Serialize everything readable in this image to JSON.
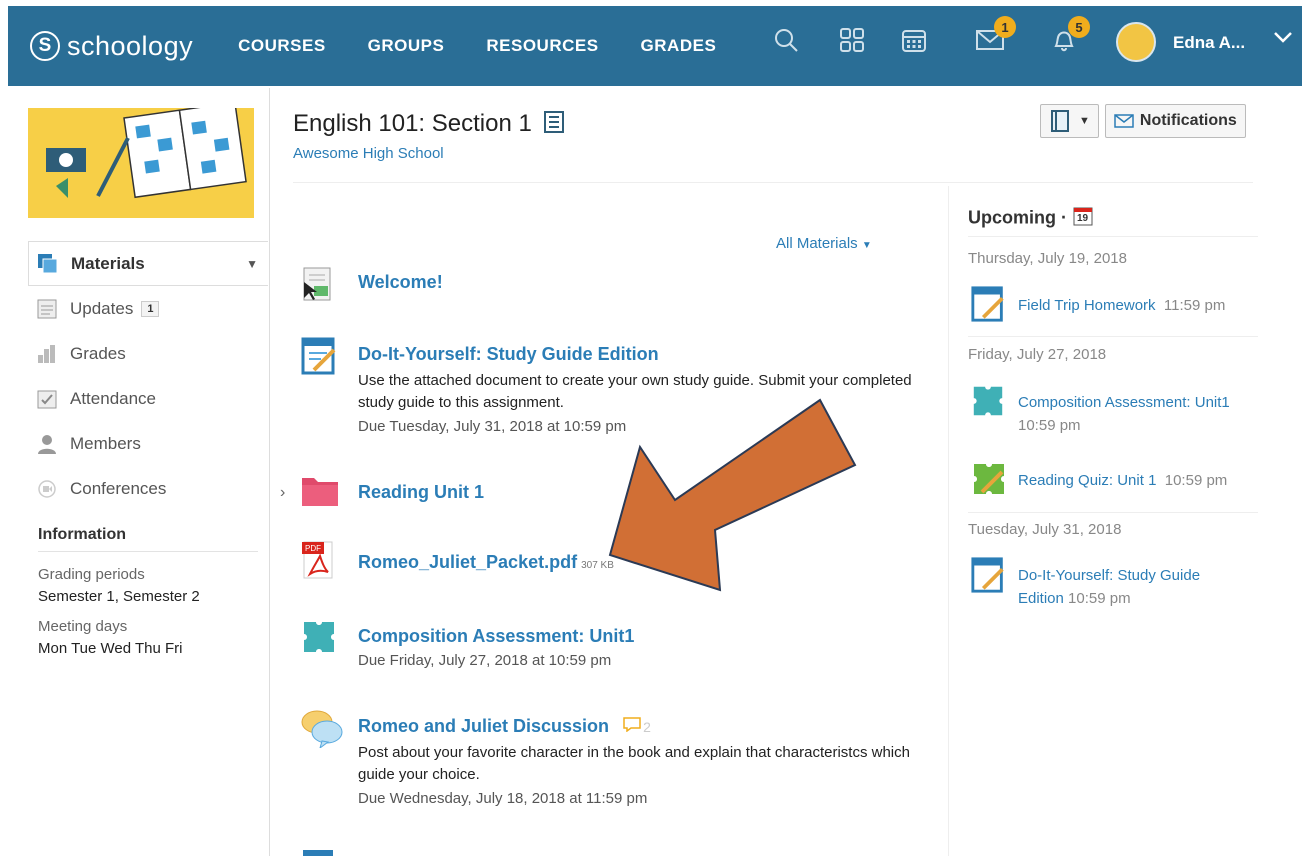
{
  "nav": {
    "logo_text": "schoology",
    "logo_letter": "S",
    "links": [
      "COURSES",
      "GROUPS",
      "RESOURCES",
      "GRADES"
    ],
    "messages_count": "1",
    "notifications_count": "5",
    "user_name": "Edna A...",
    "colors": {
      "bar": "#2a6e96",
      "badge": "#f0ad1d"
    }
  },
  "sidebar": {
    "menu": [
      {
        "label": "Materials",
        "icon": "materials-icon"
      },
      {
        "label": "Updates",
        "icon": "updates-icon",
        "count": "1"
      },
      {
        "label": "Grades",
        "icon": "grades-icon"
      },
      {
        "label": "Attendance",
        "icon": "attendance-icon"
      },
      {
        "label": "Members",
        "icon": "members-icon"
      },
      {
        "label": "Conferences",
        "icon": "conferences-icon"
      }
    ],
    "info_title": "Information",
    "grading_periods_label": "Grading periods",
    "grading_periods_value": "Semester 1, Semester 2",
    "meeting_days_label": "Meeting days",
    "meeting_days_value": "Mon Tue Wed Thu Fri"
  },
  "course": {
    "title": "English 101: Section 1",
    "school": "Awesome High School",
    "notifications_button": "Notifications",
    "filter_label": "All Materials"
  },
  "materials": [
    {
      "title": "Welcome!",
      "icon": "page-icon"
    },
    {
      "title": "Do-It-Yourself: Study Guide Edition",
      "icon": "assignment-icon",
      "desc": "Use the attached document to create your own study guide. Submit your completed study guide to this assignment.",
      "due": "Due Tuesday, July 31, 2018 at 10:59 pm"
    },
    {
      "title": "Reading Unit 1",
      "icon": "folder-icon"
    },
    {
      "title": "Romeo_Juliet_Packet.pdf",
      "icon": "pdf-icon",
      "size": "307 KB"
    },
    {
      "title": "Composition Assessment: Unit1",
      "icon": "assessment-icon",
      "due": "Due Friday, July 27, 2018 at 10:59 pm"
    },
    {
      "title": "Romeo and Juliet Discussion",
      "icon": "discussion-icon",
      "comments": "2",
      "desc": "Post about your favorite character in the book and explain that characteristcs which guide your choice.",
      "due": "Due Wednesday, July 18, 2018 at 11:59 pm"
    }
  ],
  "upcoming": {
    "title": "Upcoming ·",
    "calendar_day": "19",
    "groups": [
      {
        "date": "Thursday, July 19, 2018",
        "items": [
          {
            "title": "Field Trip Homework",
            "time": "11:59 pm",
            "icon": "assignment-icon"
          }
        ]
      },
      {
        "date": "Friday, July 27, 2018",
        "items": [
          {
            "title": "Composition Assessment: Unit1",
            "time": "10:59 pm",
            "icon": "assessment-icon"
          },
          {
            "title": "Reading Quiz: Unit 1",
            "time": "10:59 pm",
            "icon": "quiz-icon"
          }
        ]
      },
      {
        "date": "Tuesday, July 31, 2018",
        "items": [
          {
            "title": "Do-It-Yourself: Study Guide Edition",
            "time": "10:59 pm",
            "icon": "assignment-icon"
          }
        ]
      }
    ]
  }
}
